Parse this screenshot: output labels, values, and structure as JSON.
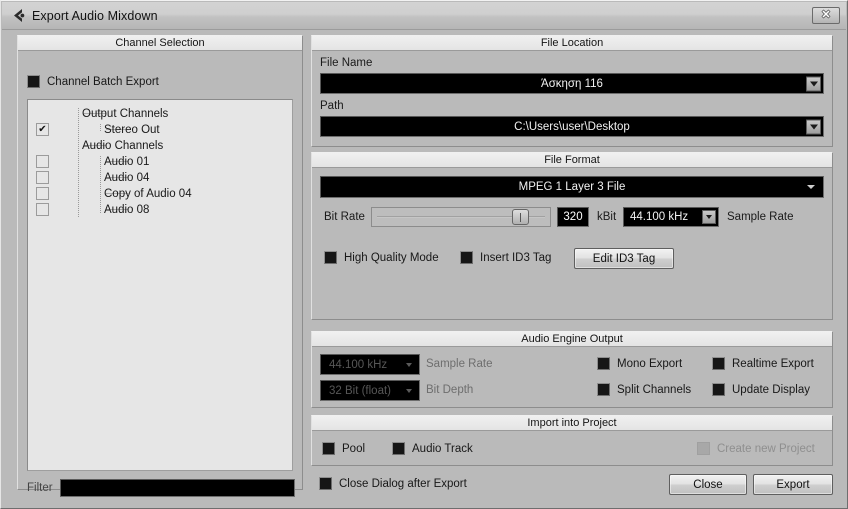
{
  "window": {
    "title": "Export Audio Mixdown",
    "icon": "cubase-logo-icon",
    "close_label": "✕"
  },
  "channel_selection": {
    "title": "Channel Selection",
    "batch_export": {
      "label": "Channel Batch Export",
      "checked": true
    },
    "tree": [
      {
        "label": "Output Channels",
        "indent": 0,
        "has_checkbox": false,
        "checked": false
      },
      {
        "label": "Stereo Out",
        "indent": 1,
        "has_checkbox": true,
        "checked": true
      },
      {
        "label": "Audio Channels",
        "indent": 0,
        "has_checkbox": false,
        "checked": false
      },
      {
        "label": "Audio 01",
        "indent": 1,
        "has_checkbox": true,
        "checked": false
      },
      {
        "label": "Audio 04",
        "indent": 1,
        "has_checkbox": true,
        "checked": false
      },
      {
        "label": "Copy of Audio 04",
        "indent": 1,
        "has_checkbox": true,
        "checked": false
      },
      {
        "label": "Audio 08",
        "indent": 1,
        "has_checkbox": true,
        "checked": false
      }
    ],
    "filter": {
      "label": "Filter",
      "value": "",
      "placeholder": ""
    }
  },
  "file_location": {
    "title": "File Location",
    "file_name_label": "File Name",
    "file_name_value": "Άσκηση 116",
    "path_label": "Path",
    "path_value": "C:\\Users\\user\\Desktop"
  },
  "file_format": {
    "title": "File Format",
    "format_value": "MPEG 1 Layer 3 File",
    "bit_rate_label": "Bit Rate",
    "bit_rate_value": "320",
    "bit_rate_unit": "kBit",
    "bit_rate_percent": 88,
    "sample_rate_value": "44.100 kHz",
    "sample_rate_label": "Sample Rate",
    "high_quality": {
      "label": "High Quality Mode",
      "checked": true
    },
    "insert_id3": {
      "label": "Insert ID3 Tag",
      "checked": true
    },
    "edit_id3_button": "Edit ID3 Tag"
  },
  "audio_engine": {
    "title": "Audio Engine Output",
    "sample_rate_value": "44.100 kHz",
    "sample_rate_label": "Sample Rate",
    "bit_depth_value": "32 Bit (float)",
    "bit_depth_label": "Bit Depth",
    "mono_export": {
      "label": "Mono Export",
      "checked": true
    },
    "split_channels": {
      "label": "Split Channels",
      "checked": true
    },
    "realtime_export": {
      "label": "Realtime Export",
      "checked": true
    },
    "update_display": {
      "label": "Update Display",
      "checked": true
    }
  },
  "import_project": {
    "title": "Import into Project",
    "pool": {
      "label": "Pool",
      "checked": true
    },
    "audio_track": {
      "label": "Audio Track",
      "checked": true
    },
    "create_new_project": {
      "label": "Create new Project",
      "checked": false,
      "disabled": true
    }
  },
  "footer": {
    "close_after_export": {
      "label": "Close Dialog after Export",
      "checked": true
    },
    "close_button": "Close",
    "export_button": "Export"
  },
  "colors": {
    "dialog_bg": "#bababa",
    "group_header": "#e8e8e8",
    "field_bg": "#000000",
    "field_text": "#f2f2f2",
    "tree_bg": "#e6e6e6"
  }
}
